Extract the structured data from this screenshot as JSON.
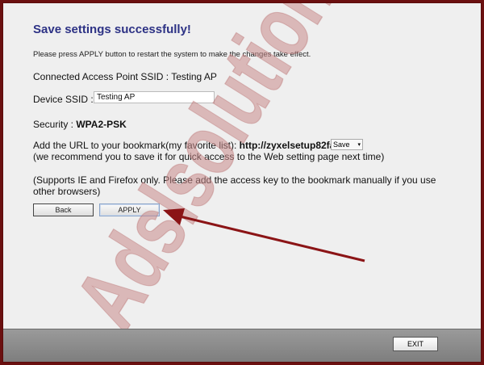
{
  "page": {
    "title": "Save settings successfully!",
    "note": "Please press APPLY button to restart the system to make the changes take effect.",
    "connected_label": "Connected Access Point SSID : Testing AP",
    "device_ssid_label": "Device SSID :",
    "device_ssid_value": "Testing AP",
    "security_label": "Security :",
    "security_value": "WPA2-PSK",
    "bookmark_label": "Add the URL to your bookmark(my favorite list):",
    "bookmark_url": "http://zyxelsetup82fa",
    "bookmark_select_value": "Save",
    "recommend_text": "(we recommend you to save it for quick access to the Web setting page next time)",
    "supports_text": "(Supports IE and Firefox only. Please add the access key to the bookmark manually if you use other browsers)",
    "back_label": "Back",
    "apply_label": "APPLY",
    "exit_label": "EXIT"
  },
  "watermark": {
    "text": "Adslsolution"
  },
  "colors": {
    "title": "#2d3285",
    "watermark": "#c98a8a",
    "arrow": "#8b1416",
    "border": "#6b1010"
  }
}
